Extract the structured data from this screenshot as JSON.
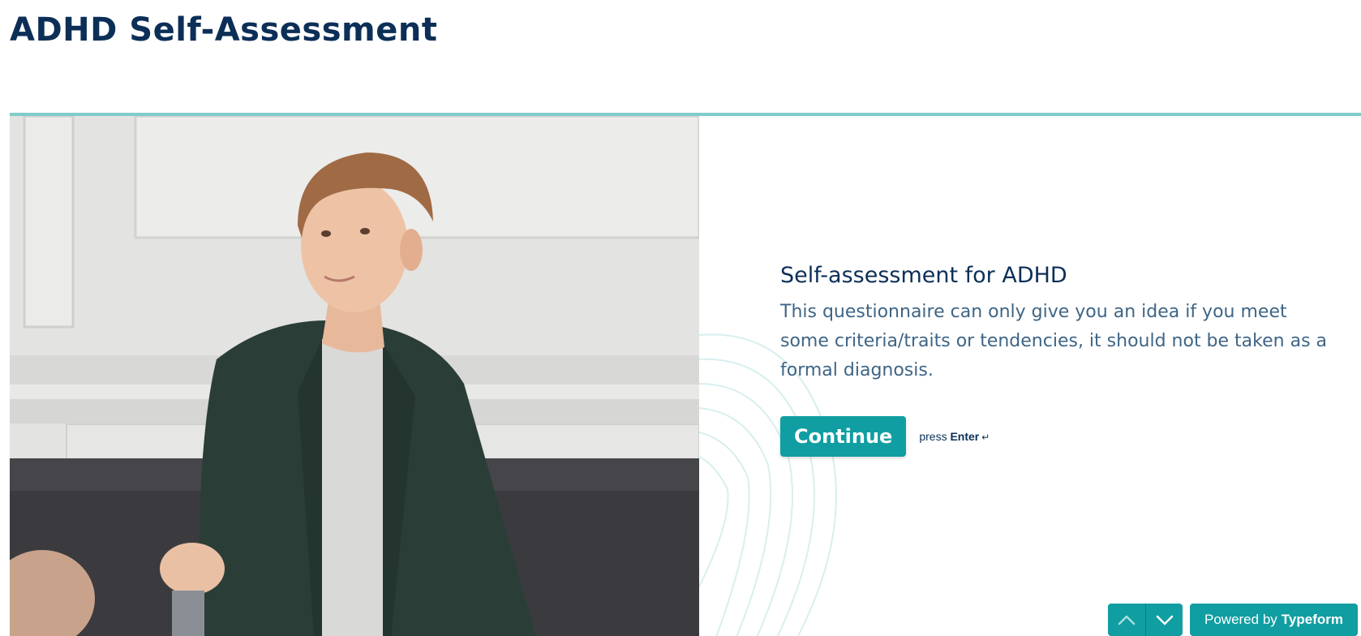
{
  "page": {
    "title": "ADHD Self-Assessment"
  },
  "form": {
    "welcome_title": "Self-assessment for ADHD",
    "welcome_description": "This questionnaire can only give you an idea if you meet some criteria/traits or tendencies, it should not be taken as a formal diagnosis.",
    "continue_label": "Continue",
    "press_label": "press",
    "enter_label": "Enter",
    "enter_glyph": "↵"
  },
  "footer": {
    "prev_icon": "chevron-up-icon",
    "next_icon": "chevron-down-icon",
    "powered_prefix": "Powered by",
    "powered_brand": "Typeform"
  },
  "colors": {
    "accent": "#109ea2",
    "title": "#0c2f57",
    "description": "#3f6585",
    "divider": "#7fccca"
  }
}
